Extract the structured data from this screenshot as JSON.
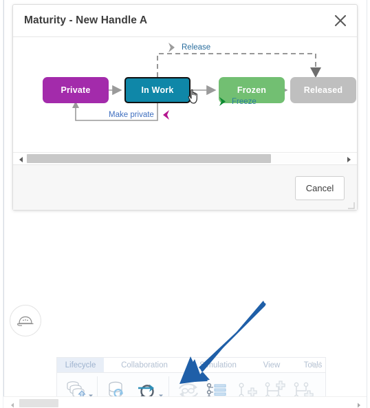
{
  "dialog": {
    "title": "Maturity - New Handle A",
    "close_icon": "close-icon",
    "cancel_label": "Cancel"
  },
  "diagram": {
    "states": [
      {
        "id": "private",
        "label": "Private",
        "color": "#a32bab",
        "selected": false
      },
      {
        "id": "in_work",
        "label": "In Work",
        "color": "#0f87a8",
        "selected": true
      },
      {
        "id": "frozen",
        "label": "Frozen",
        "color": "#72bf72",
        "selected": false
      },
      {
        "id": "released",
        "label": "Released",
        "color": "#bfbfbf",
        "selected": false
      }
    ],
    "transitions": [
      {
        "id": "release",
        "label": "Release",
        "color": "#2a6e9e",
        "style": "dashed",
        "marker": "grey-chevron"
      },
      {
        "id": "freeze",
        "label": "Freeze",
        "color": "#2a7e9e",
        "style": "solid",
        "marker": "green-chevron"
      },
      {
        "id": "make_private",
        "label": "Make private",
        "color": "#3f6fbf",
        "style": "solid",
        "marker": "magenta-chevron"
      }
    ],
    "scrollbar": {
      "left_arrow_icon": "triangle-left-icon",
      "right_arrow_icon": "triangle-right-icon"
    }
  },
  "avatar": {
    "icon": "hard-hat-icon"
  },
  "ribbon": {
    "tabs": [
      {
        "id": "lifecycle",
        "label": "Lifecycle",
        "active": true
      },
      {
        "id": "collaboration",
        "label": "Collaboration",
        "active": false
      },
      {
        "id": "simulation",
        "label": "Simulation",
        "active": false
      },
      {
        "id": "view",
        "label": "View",
        "active": false
      },
      {
        "id": "tools",
        "label": "Tools",
        "active": false
      }
    ],
    "collapse_icon": "chevron-down-icon",
    "buttons": [
      {
        "id": "share",
        "icon": "stacked-disks-up-arrow-icon",
        "has_caret": true,
        "disabled": false
      },
      {
        "id": "refresh-lifecycle",
        "icon": "database-refresh-icon",
        "has_caret": false,
        "disabled": false
      },
      {
        "id": "find",
        "icon": "magnifier-arrow-icon",
        "has_caret": true,
        "disabled": false
      },
      {
        "id": "change-maturity",
        "icon": "circular-arrows-icon",
        "has_caret": false,
        "disabled": true
      },
      {
        "id": "lifecycle-tree",
        "icon": "branch-list-icon",
        "has_caret": false,
        "disabled": false
      },
      {
        "id": "new-branch-point",
        "icon": "node-plus-icon",
        "has_caret": false,
        "disabled": true
      },
      {
        "id": "new-branch",
        "icon": "branch-plus-icon",
        "has_caret": false,
        "disabled": true
      },
      {
        "id": "new-version",
        "icon": "fork-plus-icon",
        "has_caret": false,
        "disabled": true
      }
    ]
  },
  "page_scrollbar": {
    "left_arrow_icon": "triangle-left-icon",
    "right_arrow_icon": "triangle-right-icon"
  },
  "annotation": {
    "arrow_color": "#1f5fa8",
    "arrow_icon": "pointer-arrow-icon"
  }
}
